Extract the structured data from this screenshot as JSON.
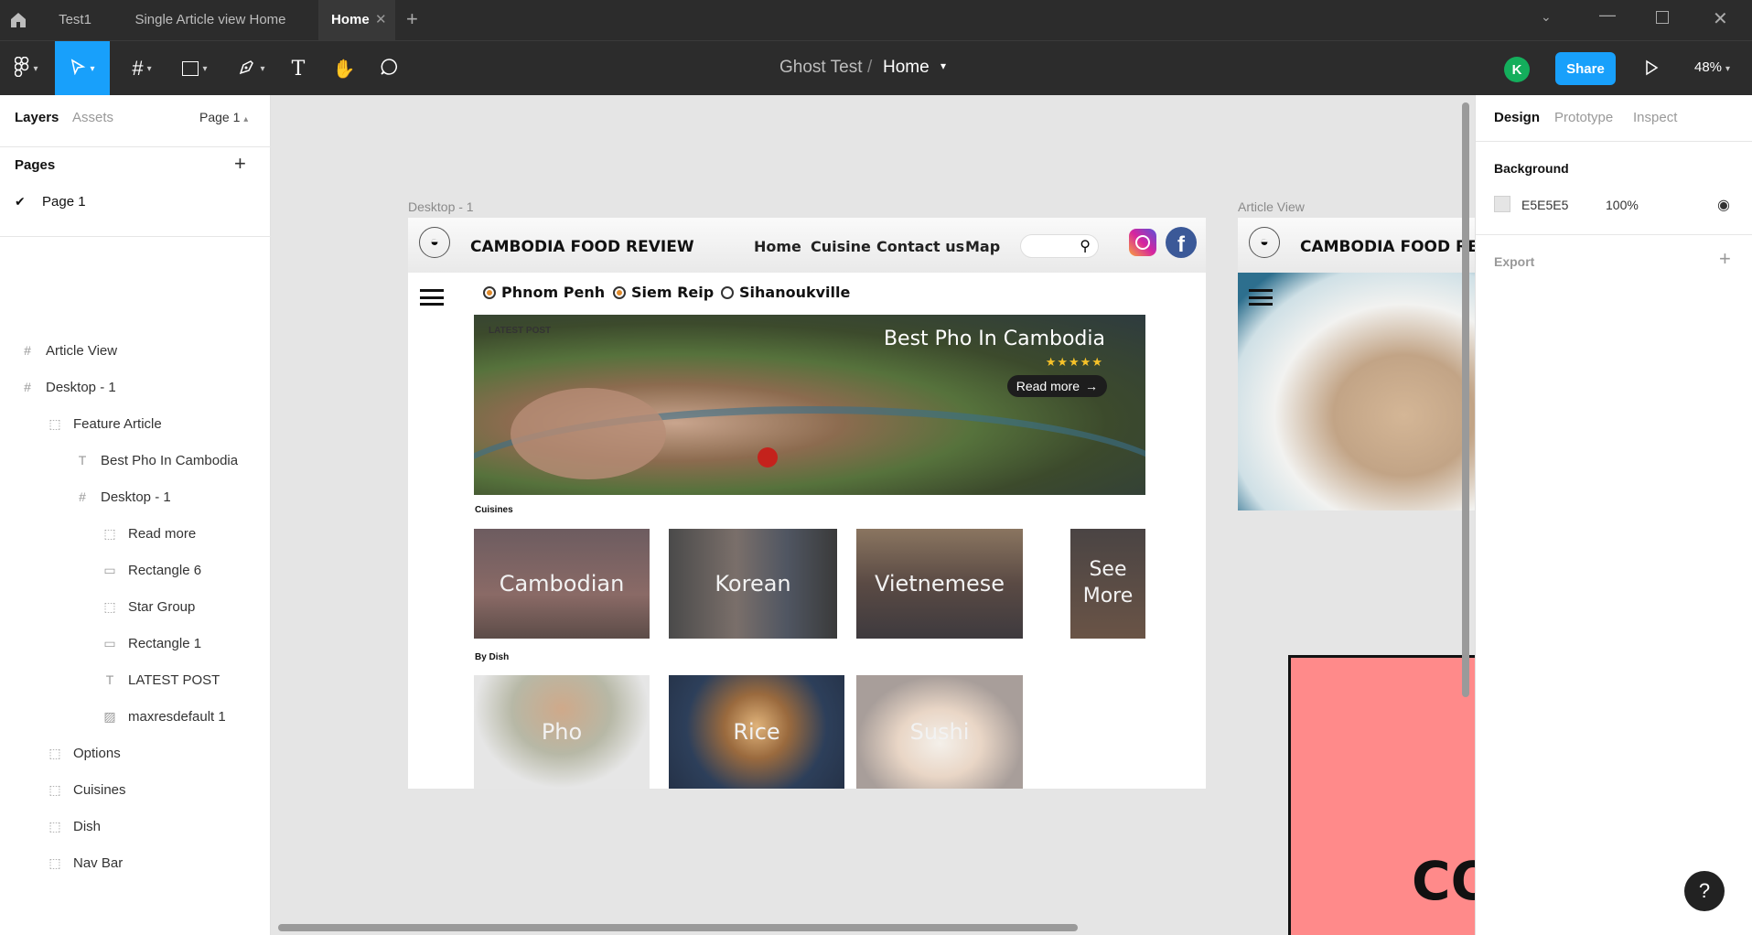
{
  "titlebar": {
    "tabs": [
      {
        "label": "Test1"
      },
      {
        "label": "Single Article view Home"
      },
      {
        "label": "Home"
      }
    ]
  },
  "toolbar": {
    "breadcrumb_project": "Ghost Test",
    "breadcrumb_sep": "/",
    "breadcrumb_page": "Home",
    "avatar_letter": "K",
    "share_label": "Share",
    "zoom": "48%"
  },
  "left": {
    "tab_layers": "Layers",
    "tab_assets": "Assets",
    "page_select": "Page 1",
    "pages_heading": "Pages",
    "page_item": "Page 1",
    "layers": [
      {
        "label": "Article View",
        "icon": "frame-icon"
      },
      {
        "label": "Desktop - 1",
        "icon": "frame-icon"
      },
      {
        "label": "Feature Article",
        "icon": "group-icon"
      },
      {
        "label": "Best Pho In Cambodia",
        "icon": "text-icon"
      },
      {
        "label": "Desktop - 1",
        "icon": "frame-icon"
      },
      {
        "label": "Read more",
        "icon": "group-icon"
      },
      {
        "label": "Rectangle 6",
        "icon": "rectangle-icon"
      },
      {
        "label": "Star Group",
        "icon": "group-icon"
      },
      {
        "label": "Rectangle 1",
        "icon": "rectangle-icon"
      },
      {
        "label": "LATEST POST",
        "icon": "text-icon"
      },
      {
        "label": "maxresdefault 1",
        "icon": "image-icon"
      },
      {
        "label": "Options",
        "icon": "group-icon"
      },
      {
        "label": "Cuisines",
        "icon": "group-icon"
      },
      {
        "label": "Dish",
        "icon": "group-icon"
      },
      {
        "label": "Nav Bar",
        "icon": "group-icon"
      }
    ]
  },
  "right": {
    "tab_design": "Design",
    "tab_prototype": "Prototype",
    "tab_inspect": "Inspect",
    "background_heading": "Background",
    "bg_hex": "E5E5E5",
    "bg_opacity": "100%",
    "export_heading": "Export"
  },
  "canvas": {
    "frame1_label": "Desktop - 1",
    "frame2_label": "Article View",
    "site_title": "CAMBODIA FOOD REVIEW",
    "nav": [
      "Home",
      "Cuisine",
      "Contact us",
      "Map"
    ],
    "locations": [
      {
        "label": "Phnom Penh",
        "selected": true
      },
      {
        "label": "Siem Reip",
        "selected": true
      },
      {
        "label": "Sihanoukville",
        "selected": false
      }
    ],
    "latest_post": "LATEST POST",
    "feature_title": "Best Pho In Cambodia",
    "stars": "★★★★★",
    "read_more": "Read more",
    "cuisines_heading": "Cuisines",
    "cuisines": [
      "Cambodian",
      "Korean",
      "Vietnemese",
      "See More"
    ],
    "dish_heading": "By Dish",
    "dishes": [
      "Pho",
      "Rice",
      "Sushi"
    ],
    "article_site_title": "CAMBODIA FOOD REVIE",
    "pink_text": "CO"
  },
  "colors": {
    "accent_blue": "#18a0fb",
    "avatar_green": "#14ae5c",
    "pink": "#ff8a8a"
  }
}
